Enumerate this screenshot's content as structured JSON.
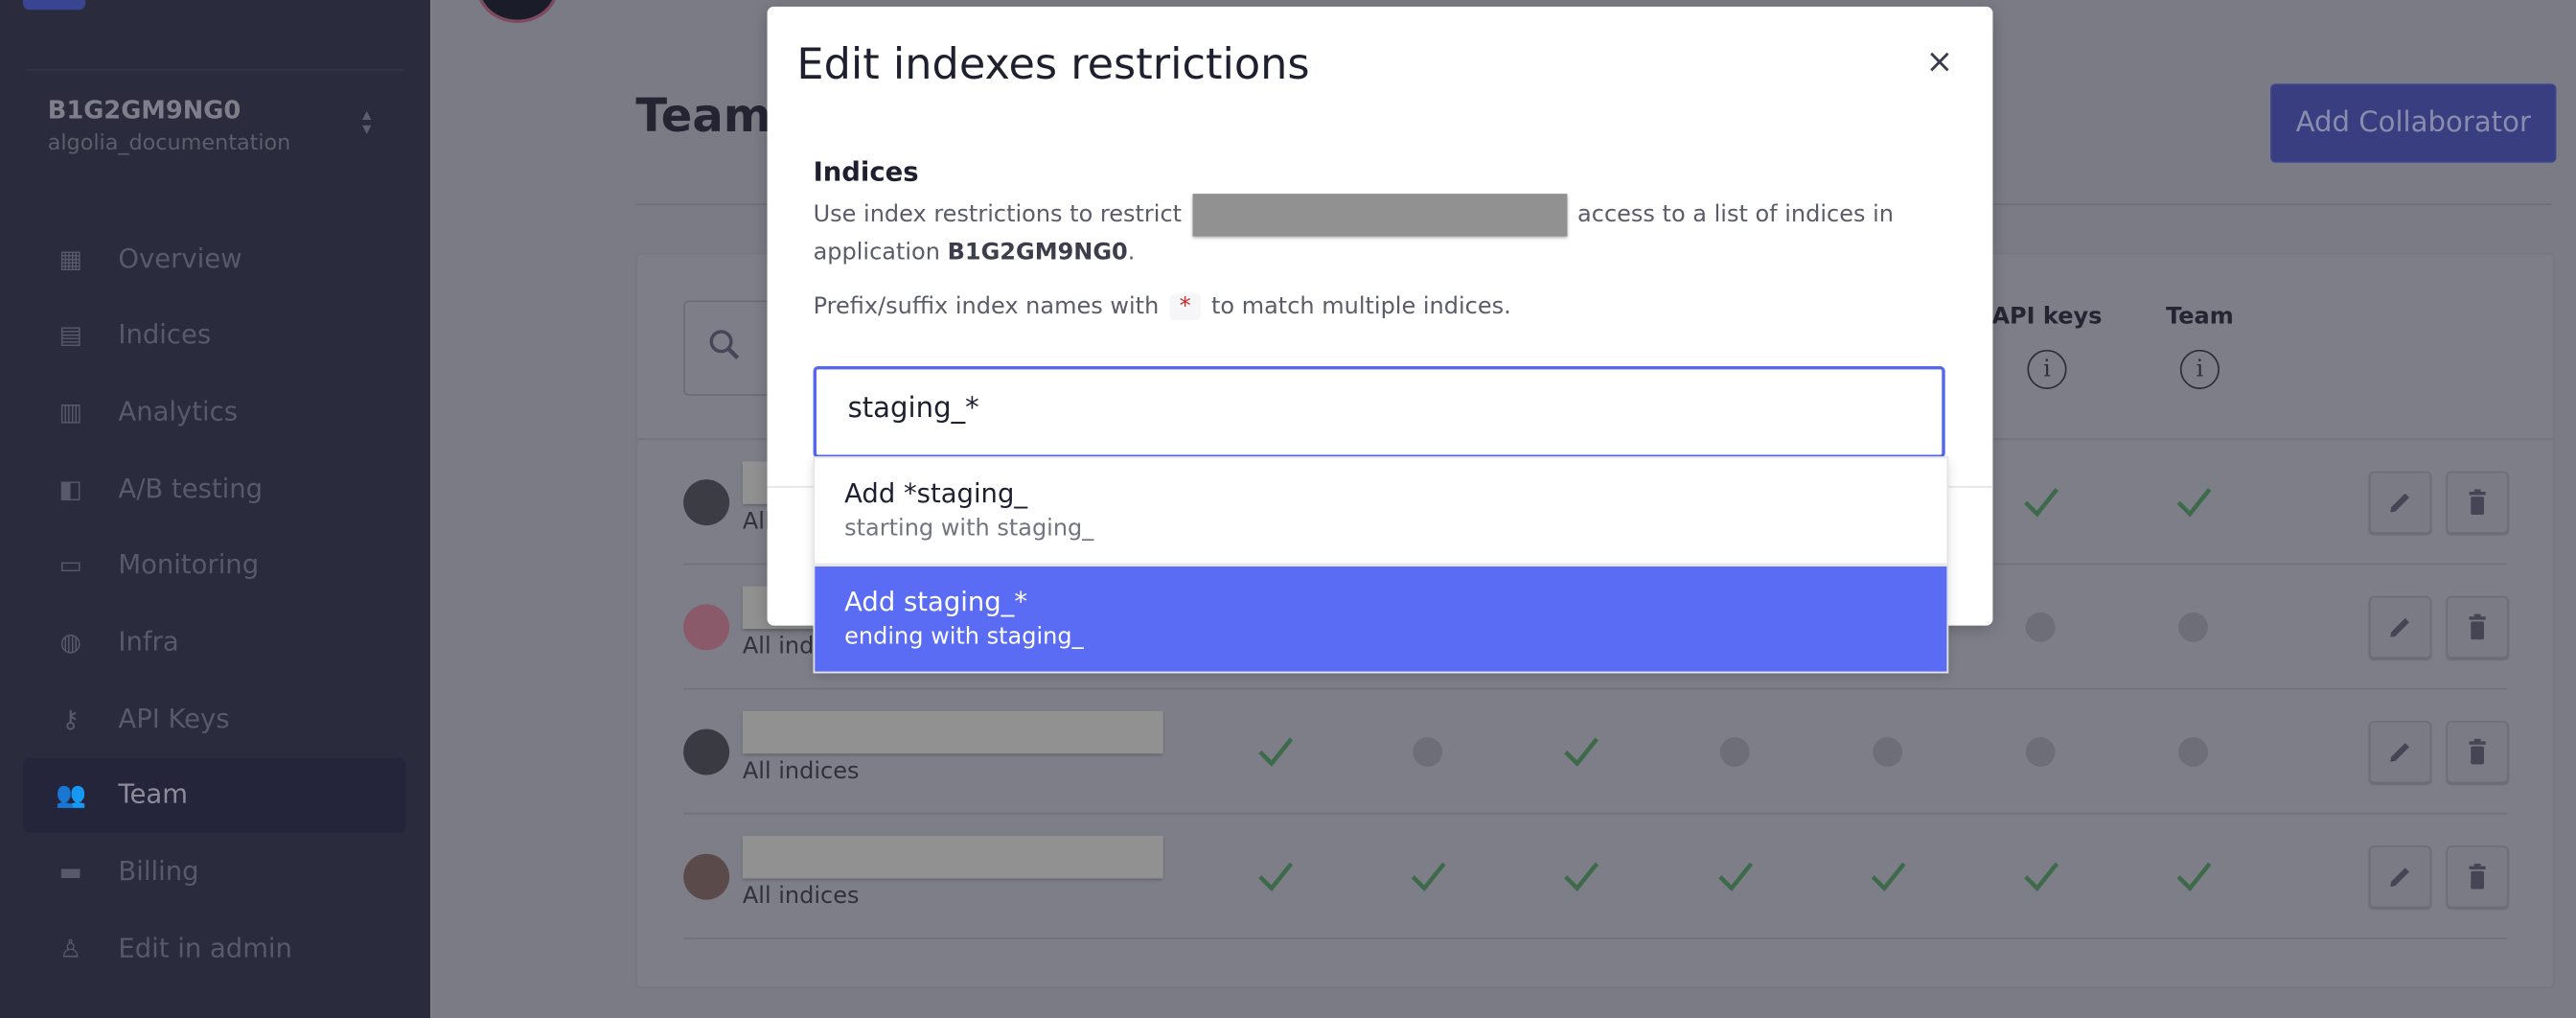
{
  "sidebar": {
    "app_id": "B1G2GM9NG0",
    "app_name": "algolia_documentation",
    "items": [
      {
        "label": "Overview",
        "icon": "overview-icon"
      },
      {
        "label": "Indices",
        "icon": "indices-icon"
      },
      {
        "label": "Analytics",
        "icon": "analytics-icon"
      },
      {
        "label": "A/B testing",
        "icon": "ab-testing-icon"
      },
      {
        "label": "Monitoring",
        "icon": "monitoring-icon"
      },
      {
        "label": "Infra",
        "icon": "globe-icon"
      },
      {
        "label": "API Keys",
        "icon": "key-icon"
      },
      {
        "label": "Team",
        "icon": "team-icon",
        "active": true
      },
      {
        "label": "Billing",
        "icon": "billing-icon"
      },
      {
        "label": "Edit in admin",
        "icon": "admin-icon"
      }
    ]
  },
  "page": {
    "title": "Team",
    "add_collaborator_label": "Add Collaborator",
    "columns": [
      "API keys",
      "Team"
    ],
    "rows": [
      {
        "scope": "All indices",
        "perms": [
          true,
          true,
          true,
          true,
          true,
          true,
          true
        ]
      },
      {
        "scope": "All indices",
        "perms": [
          true,
          false,
          true,
          false,
          false,
          false,
          false
        ]
      },
      {
        "scope": "All indices",
        "perms": [
          true,
          false,
          true,
          false,
          false,
          false,
          false
        ]
      },
      {
        "scope": "All indices",
        "perms": [
          true,
          true,
          true,
          true,
          true,
          true,
          true
        ]
      }
    ]
  },
  "modal": {
    "title": "Edit indexes restrictions",
    "close_label": "×",
    "section_title": "Indices",
    "desc_before": "Use index restrictions to restrict",
    "desc_after": "access to a list of indices in application",
    "desc_app": "B1G2GM9NG0",
    "desc_end": ".",
    "hint_before": "Prefix/suffix index names with",
    "hint_star": "*",
    "hint_after": "to match multiple indices.",
    "input_value": "staging_*",
    "options": [
      {
        "main": "Add *staging_",
        "sub": "starting with staging_",
        "highlighted": false
      },
      {
        "main": "Add staging_*",
        "sub": "ending with staging_",
        "highlighted": true
      }
    ]
  },
  "colors": {
    "accent": "#5a6cf4",
    "check": "#3d6b4a",
    "sidebar_bg": "#2a2c3d"
  }
}
